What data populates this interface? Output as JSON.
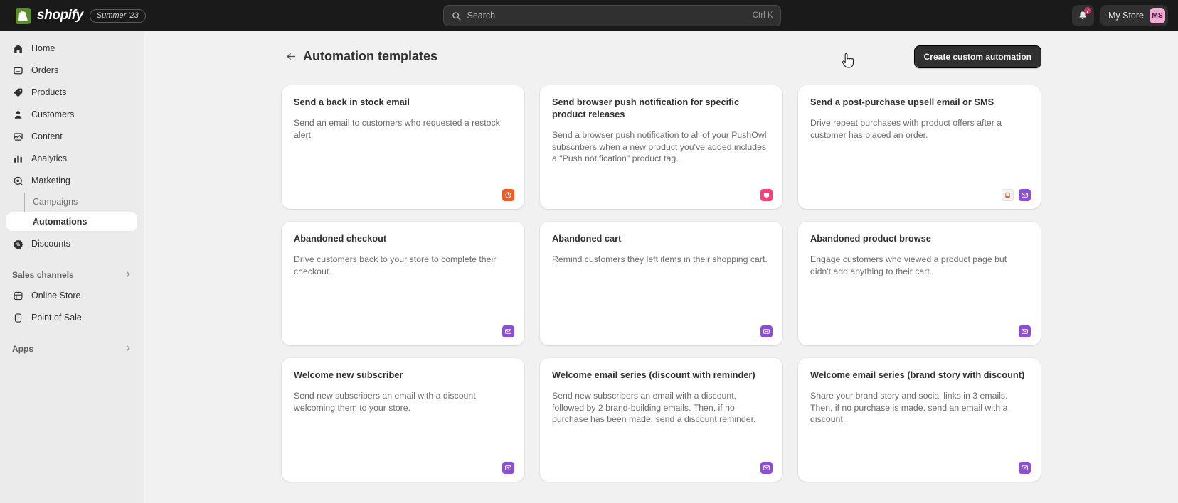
{
  "topbar": {
    "logo_name": "shopify-logo",
    "brand_word": "shopify",
    "season_badge": "Summer '23",
    "search": {
      "placeholder": "Search",
      "shortcut": "Ctrl K",
      "icon": "search-icon"
    },
    "notifications": {
      "icon": "bell-icon",
      "count": "7"
    },
    "store": {
      "name": "My Store",
      "initials": "MS"
    }
  },
  "sidebar": {
    "items": [
      {
        "label": "Home",
        "icon": "home-icon"
      },
      {
        "label": "Orders",
        "icon": "orders-inbox-icon"
      },
      {
        "label": "Products",
        "icon": "products-tag-icon"
      },
      {
        "label": "Customers",
        "icon": "customers-person-icon"
      },
      {
        "label": "Content",
        "icon": "content-image-icon"
      },
      {
        "label": "Analytics",
        "icon": "analytics-bars-icon"
      },
      {
        "label": "Marketing",
        "icon": "marketing-target-icon"
      }
    ],
    "marketing_children": [
      {
        "label": "Campaigns",
        "active": false
      },
      {
        "label": "Automations",
        "active": true
      }
    ],
    "discounts": {
      "label": "Discounts",
      "icon": "discounts-icon"
    },
    "sales_channels": {
      "label": "Sales channels",
      "chevron": "chevron-right-icon"
    },
    "channels": [
      {
        "label": "Online Store",
        "icon": "online-store-icon"
      },
      {
        "label": "Point of Sale",
        "icon": "point-of-sale-icon"
      }
    ],
    "apps": {
      "label": "Apps",
      "chevron": "chevron-right-icon"
    }
  },
  "page": {
    "back_icon": "back-arrow-icon",
    "title": "Automation templates",
    "primary_button": "Create custom automation"
  },
  "cards": [
    {
      "title": "Send a back in stock email",
      "desc": "Send an email to customers who requested a restock alert.",
      "badges": [
        {
          "name": "back-in-stock-app-icon",
          "color": "#f05a28"
        }
      ]
    },
    {
      "title": "Send browser push notification for specific product releases",
      "desc": "Send a browser push notification to all of your PushOwl subscribers when a new product you've added includes a \"Push notification\" product tag.",
      "badges": [
        {
          "name": "pushowl-app-icon",
          "color": "#ff3d77"
        }
      ]
    },
    {
      "title": "Send a post-purchase upsell email or SMS",
      "desc": "Drive repeat purchases with product offers after a customer has placed an order.",
      "badges": [
        {
          "name": "sms-app-icon",
          "color": "#f3f3f3"
        },
        {
          "name": "shopify-email-icon",
          "color": "#8a4fd6"
        }
      ]
    },
    {
      "title": "Abandoned checkout",
      "desc": "Drive customers back to your store to complete their checkout.",
      "badges": [
        {
          "name": "shopify-email-icon",
          "color": "#8a4fd6"
        }
      ]
    },
    {
      "title": "Abandoned cart",
      "desc": "Remind customers they left items in their shopping cart.",
      "badges": [
        {
          "name": "shopify-email-icon",
          "color": "#8a4fd6"
        }
      ]
    },
    {
      "title": "Abandoned product browse",
      "desc": "Engage customers who viewed a product page but didn't add anything to their cart.",
      "badges": [
        {
          "name": "shopify-email-icon",
          "color": "#8a4fd6"
        }
      ]
    },
    {
      "title": "Welcome new subscriber",
      "desc": "Send new subscribers an email with a discount welcoming them to your store.",
      "badges": [
        {
          "name": "shopify-email-icon",
          "color": "#8a4fd6"
        }
      ]
    },
    {
      "title": "Welcome email series (discount with reminder)",
      "desc": "Send new subscribers an email with a discount, followed by 2 brand-building emails. Then, if no purchase has been made, send a discount reminder.",
      "badges": [
        {
          "name": "shopify-email-icon",
          "color": "#8a4fd6"
        }
      ]
    },
    {
      "title": "Welcome email series (brand story with discount)",
      "desc": "Share your brand story and social links in 3 emails. Then, if no purchase is made, send an email with a discount.",
      "badges": [
        {
          "name": "shopify-email-icon",
          "color": "#8a4fd6"
        }
      ]
    }
  ],
  "colors": {
    "topbar_bg": "#1a1a1a",
    "sidebar_bg": "#ebebeb",
    "page_bg": "#f1f1f1",
    "accent_button": "#303030",
    "avatar_bg": "#f2a9d6",
    "badge_red": "#e0285a"
  }
}
